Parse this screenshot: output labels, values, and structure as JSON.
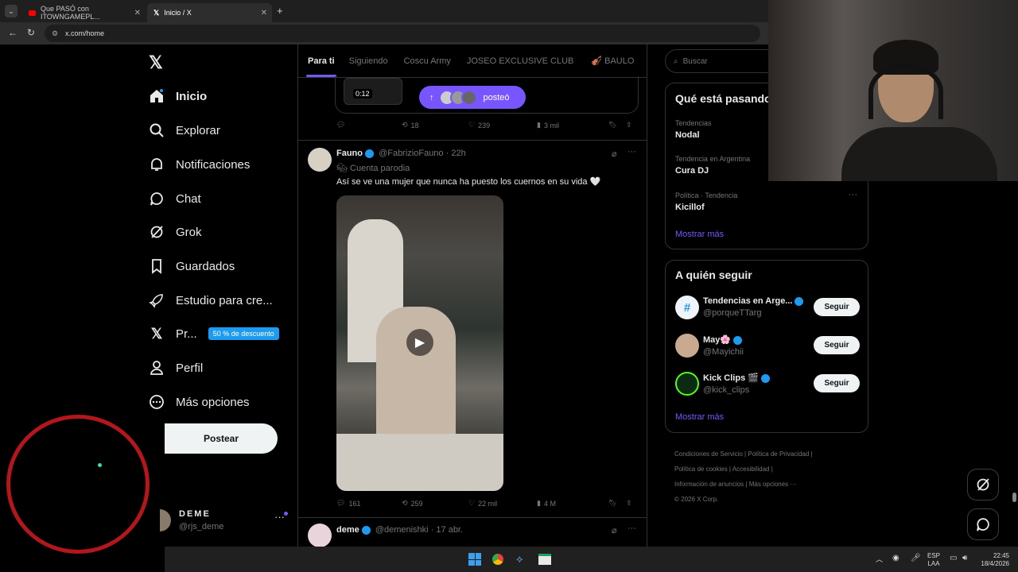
{
  "browser": {
    "tabs": [
      {
        "label": "Que PASÓ con ITOWNGAMEPL..."
      },
      {
        "label": "Inicio / X"
      }
    ],
    "url": "x.com/home"
  },
  "sidebar": {
    "items": [
      {
        "label": "Inicio",
        "icon": "home-icon"
      },
      {
        "label": "Explorar",
        "icon": "search-icon"
      },
      {
        "label": "Notificaciones",
        "icon": "bell-icon"
      },
      {
        "label": "Chat",
        "icon": "chat-icon"
      },
      {
        "label": "Grok",
        "icon": "grok-icon"
      },
      {
        "label": "Guardados",
        "icon": "bookmark-icon"
      },
      {
        "label": "Estudio para cre...",
        "icon": "rocket-icon"
      },
      {
        "label": "Pr...",
        "icon": "x-logo-icon",
        "badge": "50 % de descuento"
      },
      {
        "label": "Perfil",
        "icon": "person-icon"
      },
      {
        "label": "Más opciones",
        "icon": "more-circle-icon"
      }
    ],
    "post_button": "Postear",
    "account": {
      "name": "DEME",
      "handle": "@rjs_deme"
    }
  },
  "feed": {
    "tabs": [
      "Para ti",
      "Siguiendo",
      "Coscu Army",
      "JOSEO EXCLUSIVE CLUB",
      "🎻 BAULO"
    ],
    "prev_post": {
      "video_time": "0:12",
      "posted_pill": "posteó",
      "replies": "",
      "reposts": "18",
      "likes": "239",
      "views": "3 mil"
    },
    "post": {
      "name": "Fauno",
      "handle": "@FabrizioFauno",
      "time": "· 22h",
      "parody": "Cuenta parodia",
      "text": "Así se ve una mujer que nunca ha puesto los cuernos en su vida 🤍",
      "replies": "161",
      "reposts": "259",
      "likes": "22 mil",
      "views": "4 M"
    },
    "next_post": {
      "name": "deme",
      "handle": "@demenishki",
      "time": "· 17 abr."
    }
  },
  "right": {
    "search_placeholder": "Buscar",
    "trending_title": "Qué está pasando",
    "trends": [
      {
        "meta": "Tendencias",
        "name": "Nodal"
      },
      {
        "meta": "Tendencia en Argentina",
        "name": "Cura DJ"
      },
      {
        "meta": "Política · Tendencia",
        "name": "Kicillof"
      }
    ],
    "show_more": "Mostrar más",
    "follow_title": "A quién seguir",
    "follow": [
      {
        "name": "Tendencias en Arge...",
        "handle": "@porqueTTarg",
        "button": "Seguir"
      },
      {
        "name": "May🌸",
        "handle": "@Mayichii",
        "button": "Seguir"
      },
      {
        "name": "Kick Clips 🎬",
        "handle": "@kick_clips",
        "button": "Seguir"
      }
    ],
    "show_more_2": "Mostrar más",
    "footer": [
      "Condiciones de Servicio",
      "Política de Privacidad",
      "Política de cookies",
      "Accesibilidad",
      "Información de anuncios",
      "Más opciones ···",
      "© 2026 X Corp."
    ]
  },
  "taskbar": {
    "lang": "ESP",
    "layout": "LAA",
    "time": "22:45",
    "date": "18/4/2026"
  }
}
